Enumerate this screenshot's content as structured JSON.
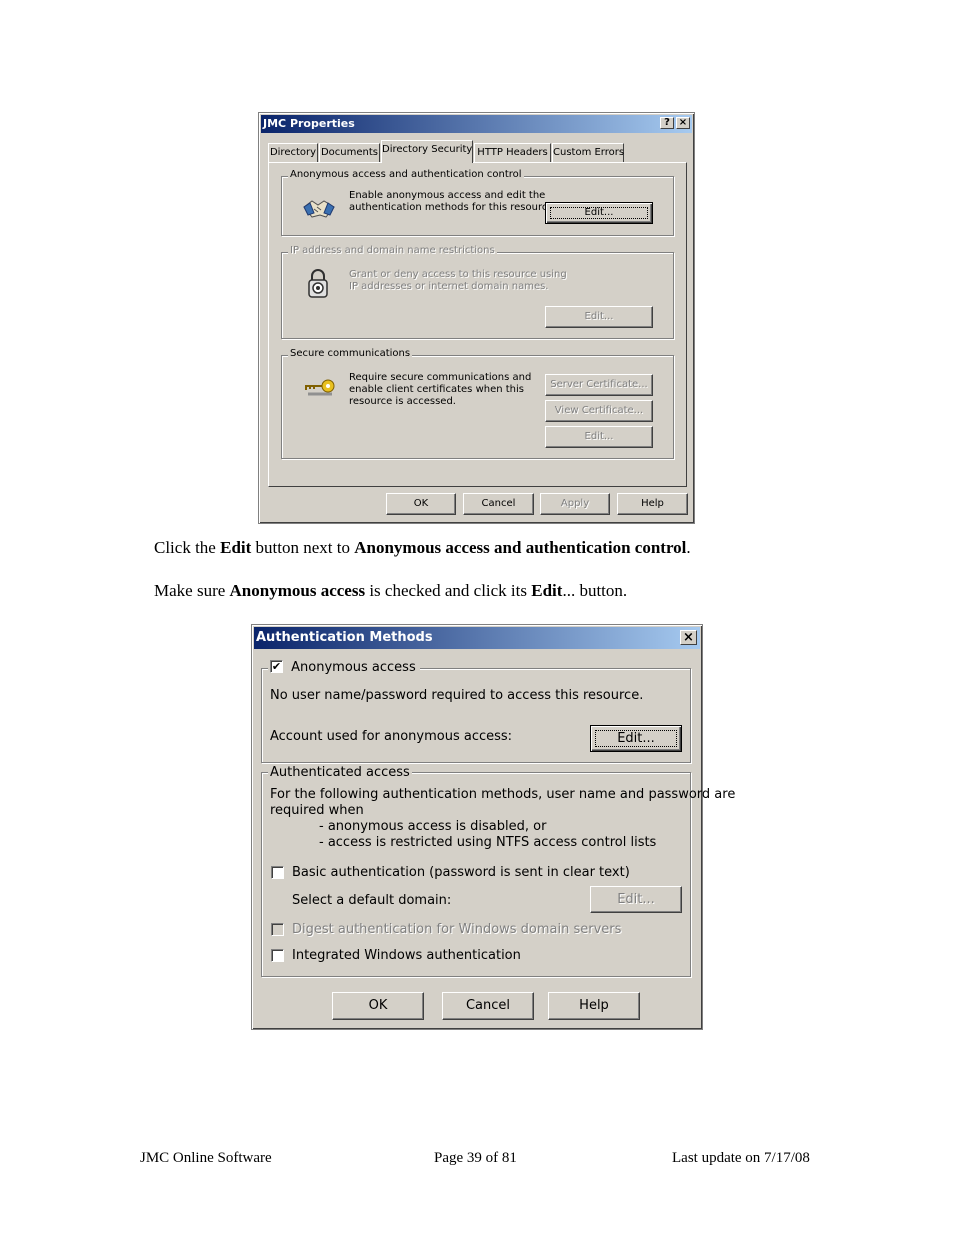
{
  "props_dialog": {
    "title": "JMC Properties",
    "help_btn": "?",
    "close_btn": "×",
    "tabs": [
      "Directory",
      "Documents",
      "Directory Security",
      "HTTP Headers",
      "Custom Errors"
    ],
    "anon_group": {
      "legend": "Anonymous access and authentication control",
      "desc1": "Enable anonymous access and edit the",
      "desc2": "authentication methods for this resource.",
      "edit": "Edit..."
    },
    "ip_group": {
      "legend": "IP address and domain name restrictions",
      "desc1": "Grant or deny access to this resource using",
      "desc2": "IP addresses or internet domain names.",
      "edit": "Edit..."
    },
    "secure_group": {
      "legend": "Secure communications",
      "desc1": "Require secure communications and",
      "desc2": "enable client certificates when this",
      "desc3": "resource is accessed.",
      "server_cert": "Server Certificate...",
      "view_cert": "View Certificate...",
      "edit": "Edit..."
    },
    "buttons": {
      "ok": "OK",
      "cancel": "Cancel",
      "apply": "Apply",
      "help": "Help"
    }
  },
  "instructions": {
    "line1": {
      "pre": "Click the ",
      "b1": "Edit",
      "mid": " button next to ",
      "b2": "Anonymous access and authentication control",
      "post": "."
    },
    "line2": {
      "pre": "Make sure ",
      "b1": "Anonymous access",
      "mid": " is checked and click its ",
      "b2": "Edit",
      "post": "... button."
    }
  },
  "auth_dialog": {
    "title": "Authentication Methods",
    "close_btn": "×",
    "anon": {
      "checkbox_label": "Anonymous access",
      "checked": true,
      "desc": "No user name/password required to access this resource.",
      "account_label": "Account used for anonymous access:",
      "edit": "Edit..."
    },
    "authenticated": {
      "legend": "Authenticated access",
      "desc1": "For the following authentication methods, user name and password are",
      "desc2": "required when",
      "bullet1": "- anonymous access is disabled, or",
      "bullet2": "- access is restricted using NTFS access control lists",
      "basic_label": "Basic authentication (password is sent in clear text)",
      "basic_checked": false,
      "domain_label": "Select a default domain:",
      "domain_edit": "Edit...",
      "digest_label": "Digest authentication for Windows domain servers",
      "digest_checked": false,
      "integrated_label": "Integrated Windows authentication",
      "integrated_checked": false
    },
    "buttons": {
      "ok": "OK",
      "cancel": "Cancel",
      "help": "Help"
    }
  },
  "footer": {
    "left": "JMC Online Software",
    "center": "Page 39 of 81",
    "right": "Last update on 7/17/08"
  }
}
